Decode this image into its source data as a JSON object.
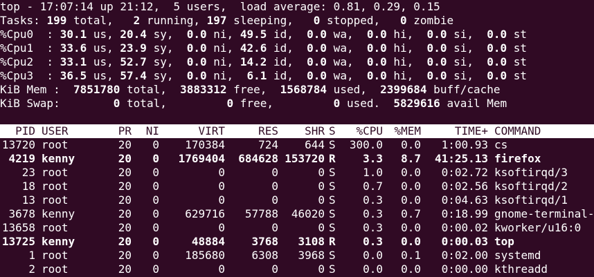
{
  "summary": {
    "uptime": "top - 17:07:14 up 21:12,  5 users,  load average: 0.81, 0.29, 0.15",
    "tasks": [
      {
        "t": "Tasks: ",
        "b": false
      },
      {
        "t": "199",
        "b": true
      },
      {
        "t": " total,   ",
        "b": false
      },
      {
        "t": "2",
        "b": true
      },
      {
        "t": " running, ",
        "b": false
      },
      {
        "t": "197",
        "b": true
      },
      {
        "t": " sleeping,   ",
        "b": false
      },
      {
        "t": "0",
        "b": true
      },
      {
        "t": " stopped,   ",
        "b": false
      },
      {
        "t": "0",
        "b": true
      },
      {
        "t": " zombie",
        "b": false
      }
    ],
    "cpu": [
      {
        "label": "%Cpu0  : ",
        "us": "30.1",
        "sy": "20.4",
        "ni": " 0.0",
        "id": "49.5",
        "wa": " 0.0",
        "hi": " 0.0",
        "si": " 0.0",
        "st": " 0.0"
      },
      {
        "label": "%Cpu1  : ",
        "us": "33.6",
        "sy": "23.9",
        "ni": " 0.0",
        "id": "42.6",
        "wa": " 0.0",
        "hi": " 0.0",
        "si": " 0.0",
        "st": " 0.0"
      },
      {
        "label": "%Cpu2  : ",
        "us": "33.1",
        "sy": "52.7",
        "ni": " 0.0",
        "id": "14.2",
        "wa": " 0.0",
        "hi": " 0.0",
        "si": " 0.0",
        "st": " 0.0"
      },
      {
        "label": "%Cpu3  : ",
        "us": "36.5",
        "sy": "57.4",
        "ni": " 0.0",
        "id": " 6.1",
        "wa": " 0.0",
        "hi": " 0.0",
        "si": " 0.0",
        "st": " 0.0"
      }
    ],
    "mem": [
      {
        "t": "KiB Mem :  ",
        "b": false
      },
      {
        "t": "7851780",
        "b": true
      },
      {
        "t": " total,  ",
        "b": false
      },
      {
        "t": "3883312",
        "b": true
      },
      {
        "t": " free,  ",
        "b": false
      },
      {
        "t": "1568784",
        "b": true
      },
      {
        "t": " used,  ",
        "b": false
      },
      {
        "t": "2399684",
        "b": true
      },
      {
        "t": " buff/cache",
        "b": false
      }
    ],
    "swap": [
      {
        "t": "KiB Swap:        ",
        "b": false
      },
      {
        "t": "0",
        "b": true
      },
      {
        "t": " total,         ",
        "b": false
      },
      {
        "t": "0",
        "b": true
      },
      {
        "t": " free,         ",
        "b": false
      },
      {
        "t": "0",
        "b": true
      },
      {
        "t": " used.  ",
        "b": false
      },
      {
        "t": "5829616",
        "b": true
      },
      {
        "t": " avail Mem",
        "b": false
      }
    ]
  },
  "table": {
    "headers": [
      "PID",
      "USER",
      "PR",
      "NI",
      "VIRT",
      "RES",
      "SHR",
      "S",
      "%CPU",
      "%MEM",
      "TIME+",
      "COMMAND"
    ],
    "rows": [
      {
        "bold": false,
        "cells": [
          "13720",
          "root",
          "20",
          "0",
          "170384",
          "724",
          "644",
          "S",
          "300.0",
          "0.0",
          "1:00.93",
          "cs"
        ]
      },
      {
        "bold": true,
        "cells": [
          "4219",
          "kenny",
          "20",
          "0",
          "1769404",
          "684628",
          "153720",
          "R",
          "3.3",
          "8.7",
          "41:25.13",
          "firefox"
        ]
      },
      {
        "bold": false,
        "cells": [
          "23",
          "root",
          "20",
          "0",
          "0",
          "0",
          "0",
          "S",
          "1.0",
          "0.0",
          "0:02.72",
          "ksoftirqd/3"
        ]
      },
      {
        "bold": false,
        "cells": [
          "18",
          "root",
          "20",
          "0",
          "0",
          "0",
          "0",
          "S",
          "0.7",
          "0.0",
          "0:02.56",
          "ksoftirqd/2"
        ]
      },
      {
        "bold": false,
        "cells": [
          "13",
          "root",
          "20",
          "0",
          "0",
          "0",
          "0",
          "S",
          "0.3",
          "0.0",
          "0:04.63",
          "ksoftirqd/1"
        ]
      },
      {
        "bold": false,
        "cells": [
          "3678",
          "kenny",
          "20",
          "0",
          "629716",
          "57788",
          "46020",
          "S",
          "0.3",
          "0.7",
          "0:18.99",
          "gnome-terminal-"
        ]
      },
      {
        "bold": false,
        "cells": [
          "13658",
          "root",
          "20",
          "0",
          "0",
          "0",
          "0",
          "S",
          "0.3",
          "0.0",
          "0:00.02",
          "kworker/u16:0"
        ]
      },
      {
        "bold": true,
        "cells": [
          "13725",
          "kenny",
          "20",
          "0",
          "48884",
          "3768",
          "3108",
          "R",
          "0.3",
          "0.0",
          "0:00.03",
          "top"
        ]
      },
      {
        "bold": false,
        "cells": [
          "1",
          "root",
          "20",
          "0",
          "185680",
          "6308",
          "3968",
          "S",
          "0.0",
          "0.1",
          "0:02.00",
          "systemd"
        ]
      },
      {
        "bold": false,
        "cells": [
          "2",
          "root",
          "20",
          "0",
          "0",
          "0",
          "0",
          "S",
          "0.0",
          "0.0",
          "0:00.00",
          "kthreadd"
        ]
      }
    ]
  },
  "colors": {
    "background": "#300a24",
    "foreground": "#ffffff"
  }
}
